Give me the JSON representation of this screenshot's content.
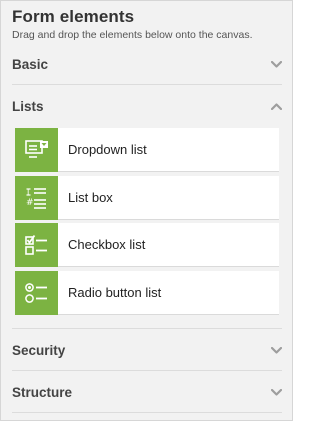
{
  "panel": {
    "title": "Form elements",
    "subtitle": "Drag and drop the elements below onto the canvas."
  },
  "sections": {
    "basic": {
      "label": "Basic",
      "expanded": false
    },
    "lists": {
      "label": "Lists",
      "expanded": true
    },
    "security": {
      "label": "Security",
      "expanded": false
    },
    "structure": {
      "label": "Structure",
      "expanded": false
    }
  },
  "list_items": [
    {
      "label": "Dropdown list",
      "icon": "dropdown-list-icon"
    },
    {
      "label": "List box",
      "icon": "list-box-icon"
    },
    {
      "label": "Checkbox list",
      "icon": "checkbox-list-icon"
    },
    {
      "label": "Radio button list",
      "icon": "radio-button-list-icon"
    }
  ],
  "colors": {
    "accent": "#7cb342",
    "panel_bg": "#f2f2f2",
    "chevron": "#9e9e9e"
  }
}
